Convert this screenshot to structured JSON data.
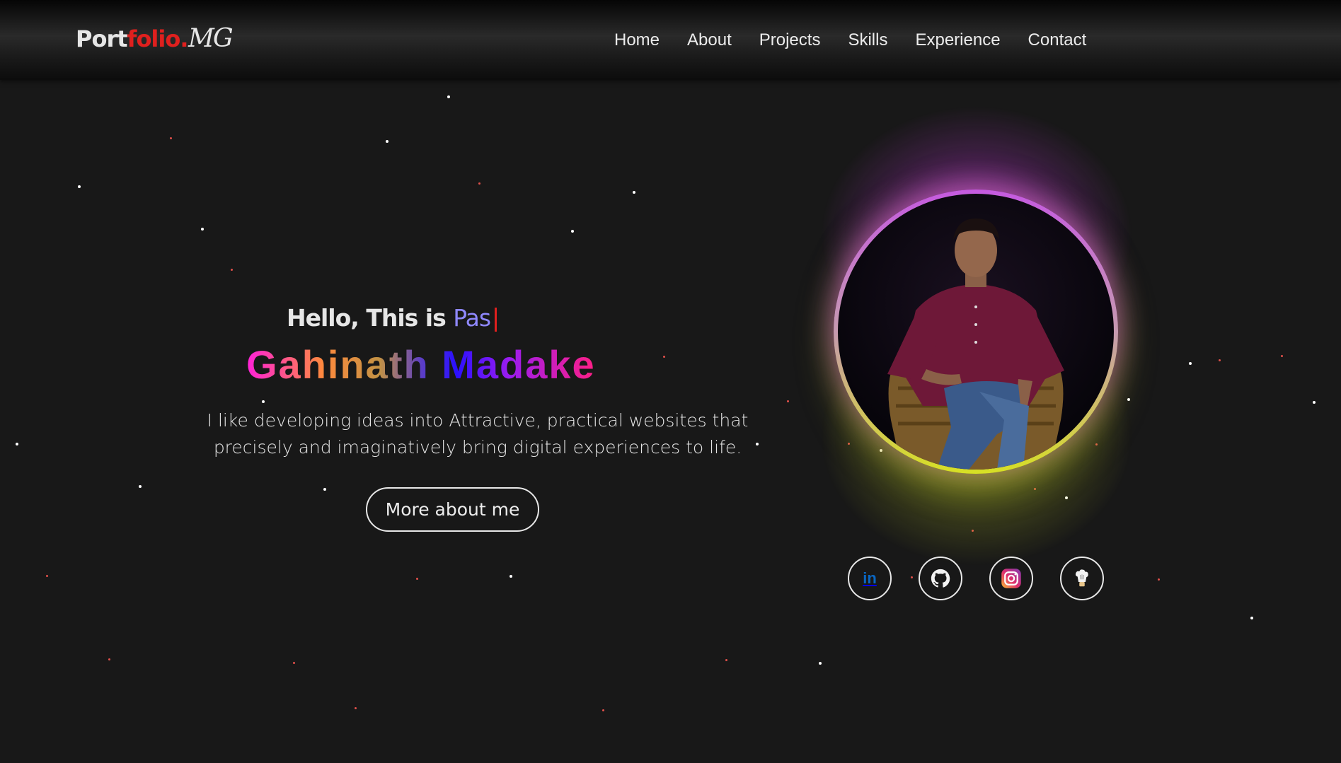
{
  "header": {
    "logo_part1": "Port",
    "logo_part2": "folio.",
    "signature": "MG",
    "nav": [
      "Home",
      "About",
      "Projects",
      "Skills",
      "Experience",
      "Contact"
    ]
  },
  "hero": {
    "greeting": "Hello, This is ",
    "typed_text": "Pas",
    "name": "Gahinath Madake",
    "description_line1": "I like developing ideas into Attractive, practical websites that",
    "description_line2": "precisely and imaginatively bring digital experiences to life.",
    "cta": "More about me"
  },
  "social": [
    {
      "name": "linkedin-icon",
      "label": "in"
    },
    {
      "name": "github-icon"
    },
    {
      "name": "instagram-icon"
    },
    {
      "name": "chef-icon"
    }
  ],
  "colors": {
    "background": "#181818",
    "accent_red": "#e0201e",
    "typed_violet": "#8f88ff",
    "ring_top": "#c55ae0",
    "ring_bottom": "#d7e024"
  }
}
